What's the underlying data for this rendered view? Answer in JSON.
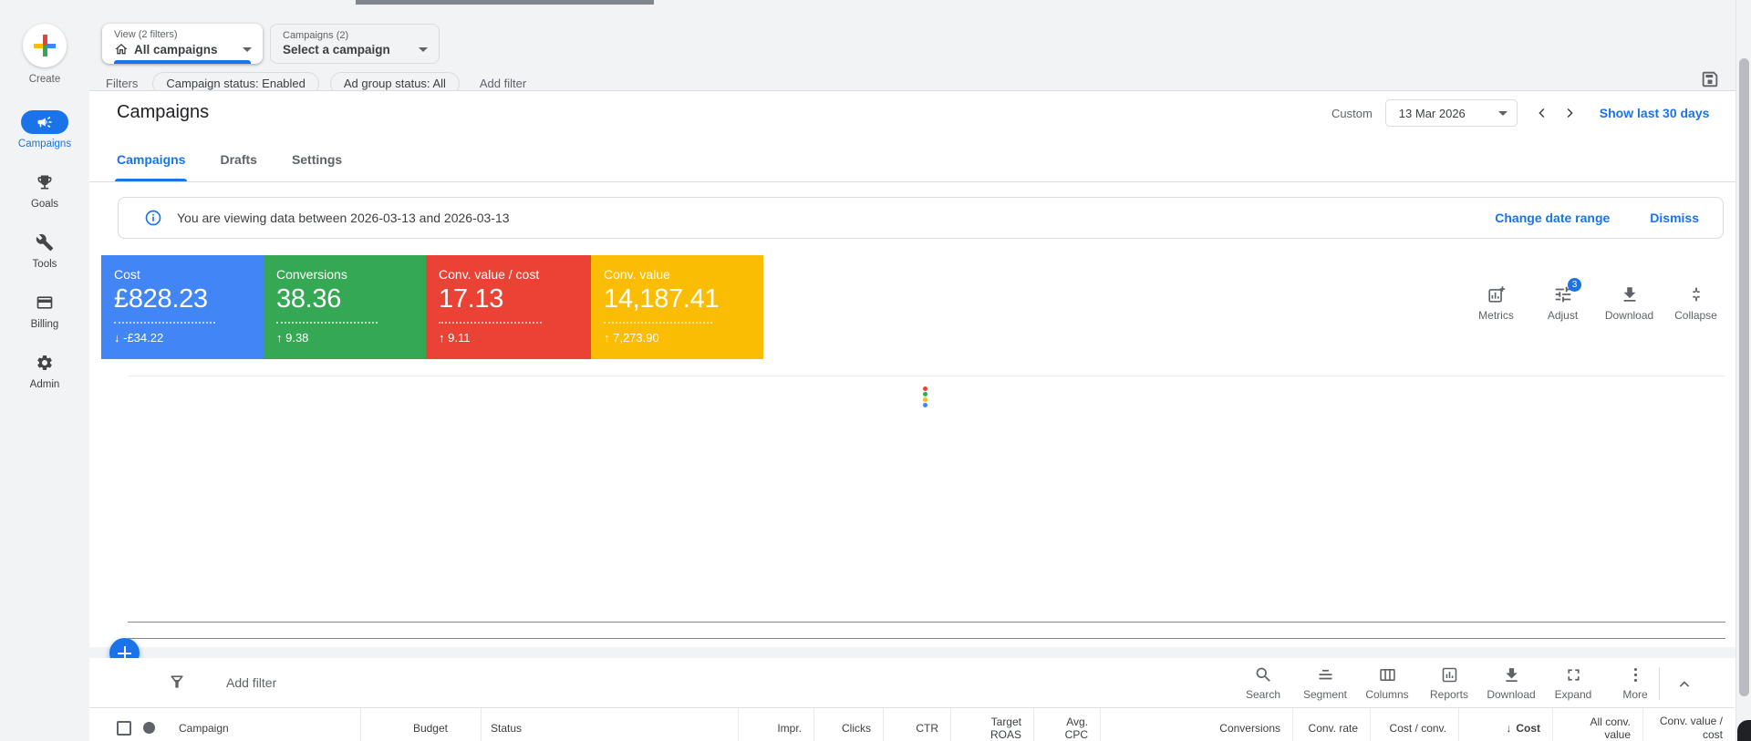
{
  "sidebar": {
    "create_label": "Create",
    "items": [
      {
        "label": "Campaigns",
        "active": true
      },
      {
        "label": "Goals",
        "active": false
      },
      {
        "label": "Tools",
        "active": false
      },
      {
        "label": "Billing",
        "active": false
      },
      {
        "label": "Admin",
        "active": false
      }
    ]
  },
  "selectors": {
    "view_label": "View (2 filters)",
    "view_value": "All campaigns",
    "campaign_label": "Campaigns (2)",
    "campaign_value": "Select a campaign"
  },
  "filters": {
    "label": "Filters",
    "chips": [
      "Campaign status: Enabled",
      "Ad group status: All"
    ],
    "add_filter": "Add filter"
  },
  "page": {
    "title": "Campaigns",
    "date_mode_label": "Custom",
    "date_value": "13 Mar 2026",
    "show_last_label": "Show last 30 days",
    "tabs": [
      "Campaigns",
      "Drafts",
      "Settings"
    ],
    "active_tab": "Campaigns"
  },
  "banner": {
    "message": "You are viewing data between 2026-03-13 and 2026-03-13",
    "change_date_range": "Change date range",
    "dismiss": "Dismiss"
  },
  "scorecards": [
    {
      "label": "Cost",
      "value": "£828.23",
      "delta": "↓ -£34.22",
      "direction": "down",
      "color": "#4285f4"
    },
    {
      "label": "Conversions",
      "value": "38.36",
      "delta": "↑ 9.38",
      "direction": "up",
      "color": "#34a853"
    },
    {
      "label": "Conv. value / cost",
      "value": "17.13",
      "delta": "↑ 9.11",
      "direction": "up",
      "color": "#ea4335"
    },
    {
      "label": "Conv. value",
      "value": "14,187.41",
      "delta": "↑ 7,273.90",
      "direction": "up",
      "color": "#fbbc04"
    }
  ],
  "chart_actions": [
    {
      "label": "Metrics"
    },
    {
      "label": "Adjust",
      "badge": "3"
    },
    {
      "label": "Download"
    },
    {
      "label": "Collapse"
    }
  ],
  "chart": {
    "points": [
      {
        "color": "#ea4335"
      },
      {
        "color": "#34a853"
      },
      {
        "color": "#fbbc04"
      },
      {
        "color": "#4285f4"
      }
    ]
  },
  "table": {
    "add_filter": "Add filter",
    "actions": [
      "Search",
      "Segment",
      "Columns",
      "Reports",
      "Download",
      "Expand",
      "More"
    ],
    "columns": [
      "Campaign",
      "Budget",
      "Status",
      "Impr.",
      "Clicks",
      "CTR",
      "Target ROAS",
      "Avg. CPC",
      "Conversions",
      "Conv. rate",
      "Cost / conv.",
      "Cost",
      "All conv. value",
      "Conv. value / cost"
    ],
    "sort": {
      "column": "Cost",
      "direction": "desc",
      "arrow": "↓"
    }
  },
  "colors": {
    "accent_blue": "#1a73e8",
    "plus_top": "#ea4335",
    "plus_bottom": "#34a853",
    "plus_left": "#fbbc04",
    "plus_right": "#4285f4"
  }
}
